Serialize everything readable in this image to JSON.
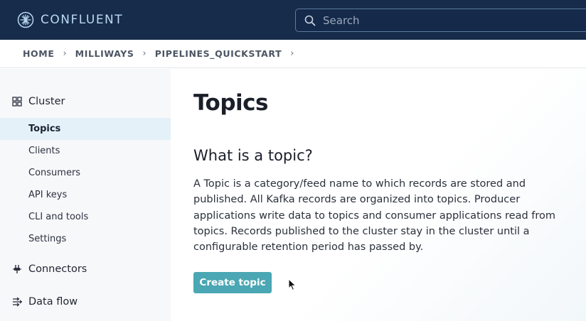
{
  "header": {
    "logo_text": "CONFLUENT",
    "logo_icon": "confluent-star-icon",
    "search": {
      "placeholder": "Search",
      "value": "",
      "icon": "search-icon"
    }
  },
  "breadcrumb": {
    "items": [
      "HOME",
      "MILLIWAYS",
      "PIPELINES_QUICKSTART"
    ]
  },
  "sidebar": {
    "sections": [
      {
        "label": "Cluster",
        "icon": "grid-icon"
      },
      {
        "label": "Connectors",
        "icon": "connectors-icon"
      },
      {
        "label": "Data flow",
        "icon": "data-flow-icon"
      }
    ],
    "items": [
      {
        "label": "Topics",
        "active": true
      },
      {
        "label": "Clients",
        "active": false
      },
      {
        "label": "Consumers",
        "active": false
      },
      {
        "label": "API keys",
        "active": false
      },
      {
        "label": "CLI and tools",
        "active": false
      },
      {
        "label": "Settings",
        "active": false
      }
    ]
  },
  "main": {
    "title": "Topics",
    "section_title": "What is a topic?",
    "description_lines": [
      "A Topic is a category/feed name to which records are stored and",
      "published. All Kafka records are organized into topics. Producer",
      "applications write data to topics and consumer applications read from",
      "topics. Records published to the cluster stay in the cluster until a",
      "configurable retention period has passed by."
    ],
    "create_button_label": "Create topic"
  },
  "colors": {
    "header_bg": "#172b4a",
    "accent_button": "#4aa7b3",
    "active_item_bg": "#e4f1f8",
    "sidebar_bg": "#f7f8f9"
  }
}
